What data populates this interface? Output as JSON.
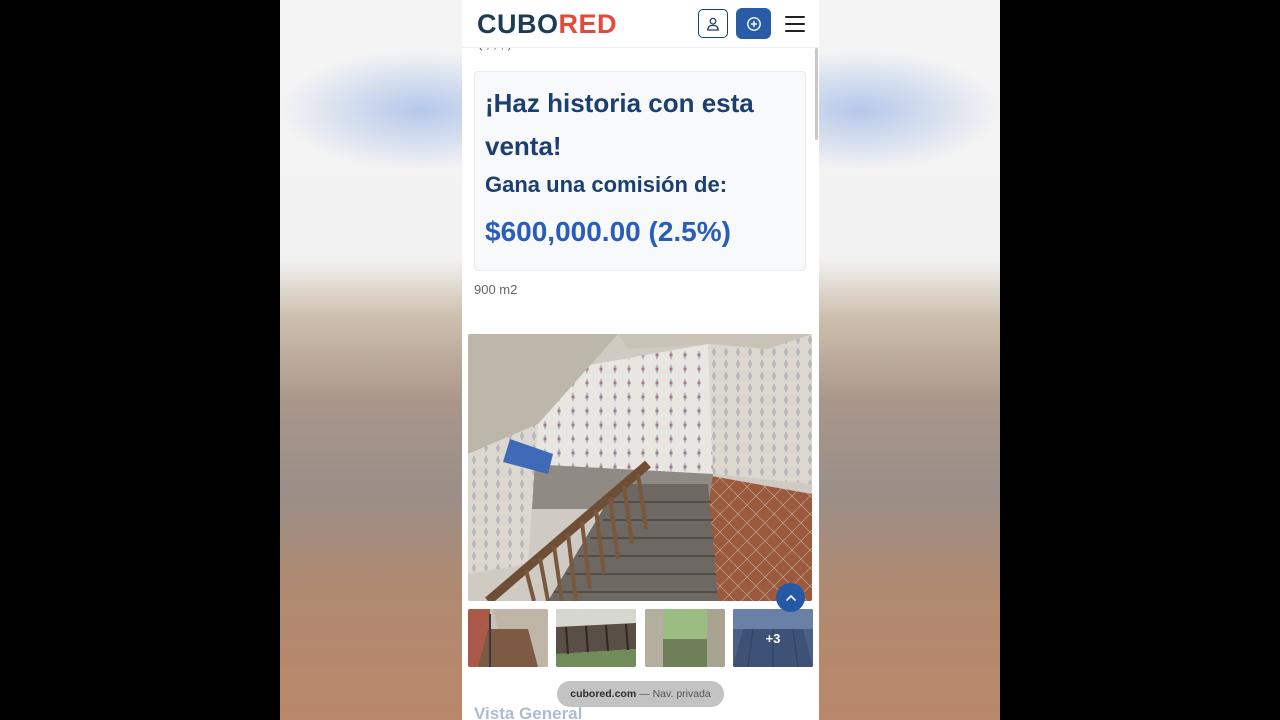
{
  "brand": {
    "logo_part1": "CUBO",
    "logo_part2": "RED",
    "color_dark": "#1d3c52",
    "color_accent": "#e24a3b"
  },
  "header": {
    "user_icon": "user-icon",
    "add_icon": "plus-circle-icon",
    "menu_icon": "hamburger-icon"
  },
  "promo": {
    "headline": "¡Haz historia con esta venta!",
    "commission_label": "Gana una comisión de:",
    "commission_amount": "$600,000.00 (2.5%)"
  },
  "listing": {
    "area": "900 m2",
    "extra_photos": "+3",
    "section_title": "Vista General"
  },
  "browser": {
    "domain": "cubored.com",
    "mode": "— Nav. privada"
  },
  "colors": {
    "primary": "#1c3f73",
    "link_blue": "#2a5dbb",
    "button_blue": "#285ca8"
  }
}
